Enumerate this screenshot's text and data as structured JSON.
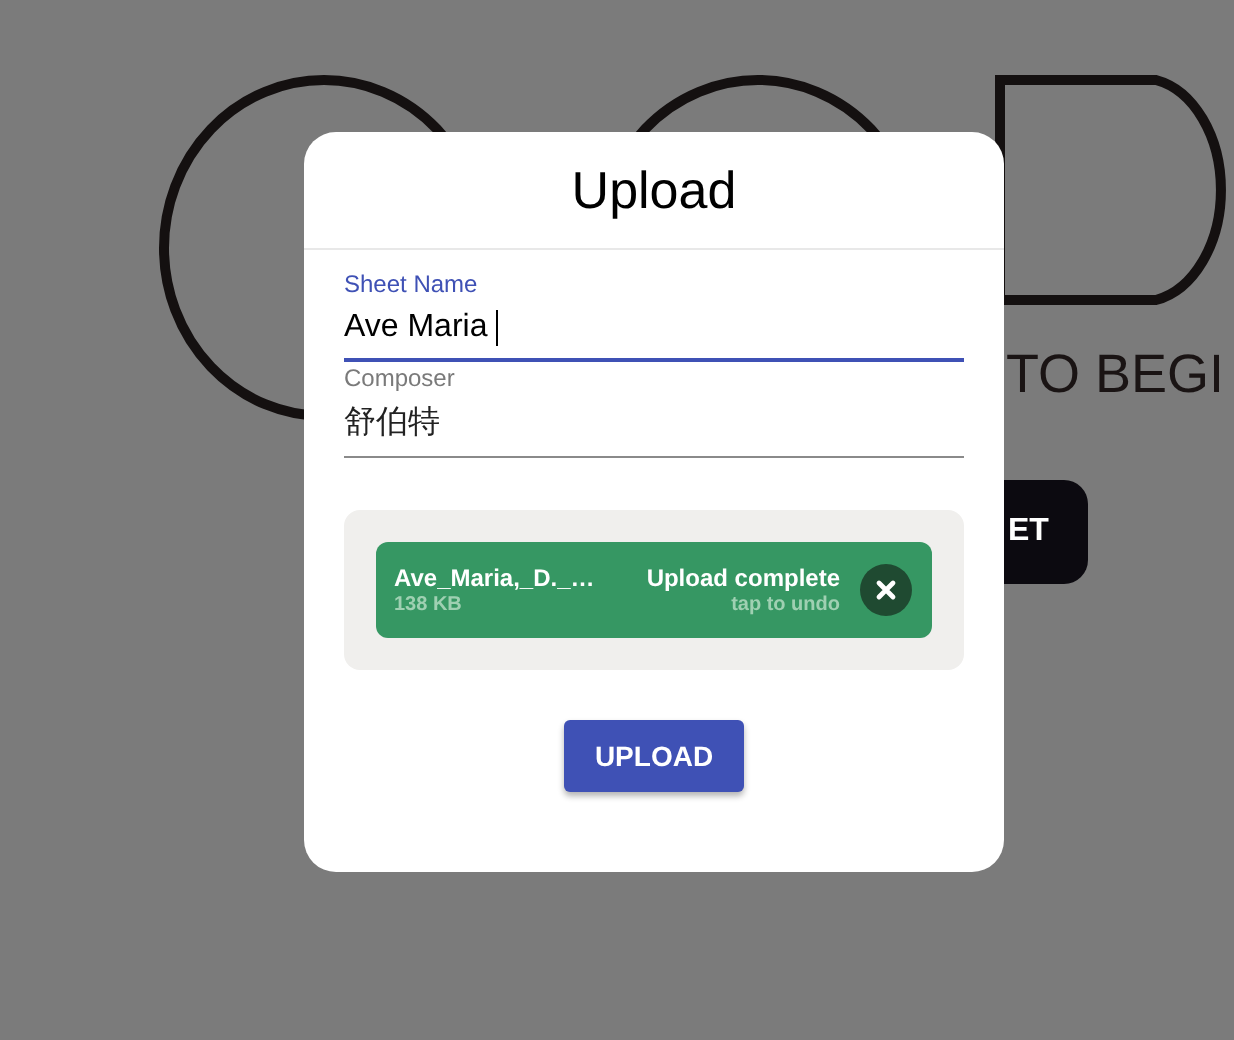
{
  "background": {
    "tagline": "TO BEGI",
    "button": "ET"
  },
  "dialog": {
    "title": "Upload",
    "fields": [
      {
        "label": "Sheet Name",
        "value": "Ave Maria",
        "focused": true
      },
      {
        "label": "Composer",
        "value": "舒伯特",
        "focused": false
      }
    ],
    "file": {
      "name": "Ave_Maria,_D._…",
      "size": "138 KB",
      "status": "Upload complete",
      "hint": "tap to undo"
    },
    "button": "UPLOAD"
  }
}
